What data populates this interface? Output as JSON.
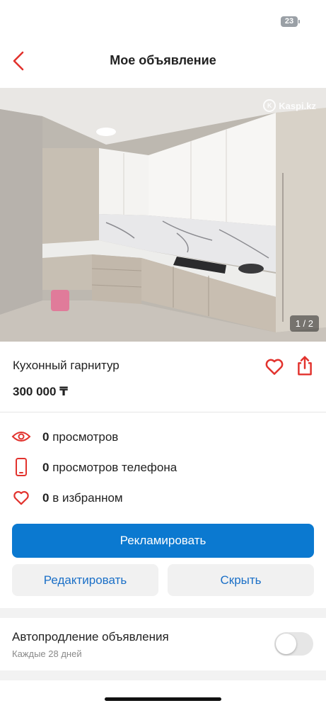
{
  "status_bar": {
    "battery_level": "23"
  },
  "nav": {
    "title": "Мое объявление",
    "back_icon": "chevron-left-icon"
  },
  "photo": {
    "watermark": "Kaspi.kz",
    "counter": "1 / 2"
  },
  "listing": {
    "title": "Кухонный гарнитур",
    "price": "300 000 ₸"
  },
  "stats": [
    {
      "icon": "eye-icon",
      "count": "0",
      "label": "просмотров"
    },
    {
      "icon": "phone-icon",
      "count": "0",
      "label": "просмотров телефона"
    },
    {
      "icon": "heart-icon",
      "count": "0",
      "label": "в избранном"
    }
  ],
  "actions": {
    "promote": "Рекламировать",
    "edit": "Редактировать",
    "hide": "Скрыть"
  },
  "autorenew": {
    "title": "Автопродление объявления",
    "subtitle": "Каждые 28 дней",
    "enabled": false
  },
  "colors": {
    "accent_red": "#e2322d",
    "primary_blue": "#0b79d0",
    "link_blue": "#1a6fc7"
  }
}
